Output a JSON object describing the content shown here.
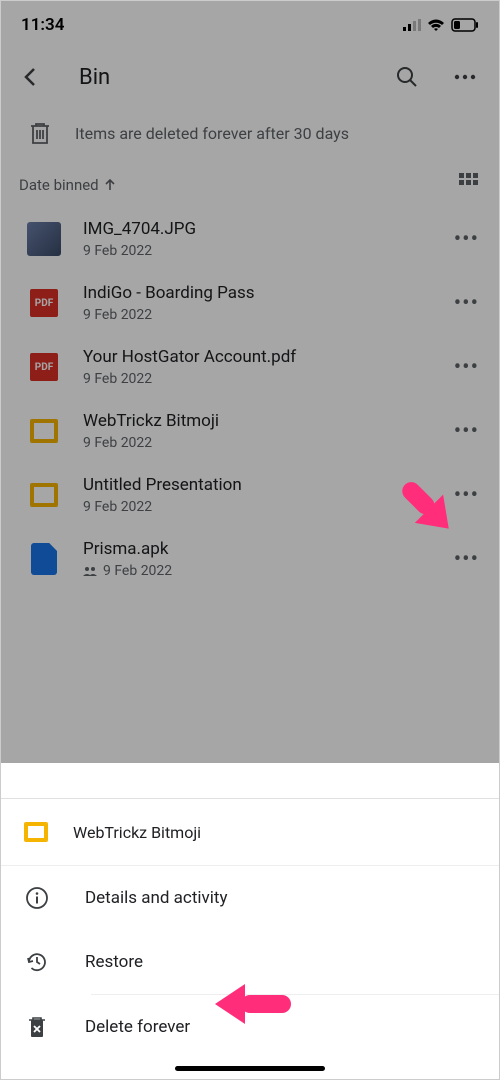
{
  "status": {
    "time": "11:34"
  },
  "header": {
    "title": "Bin"
  },
  "banner": {
    "text": "Items are deleted forever after 30 days"
  },
  "sort": {
    "label": "Date binned"
  },
  "files": [
    {
      "name": "IMG_4704.JPG",
      "date": "9 Feb 2022",
      "type": "img"
    },
    {
      "name": "IndiGo - Boarding Pass",
      "date": "9 Feb 2022",
      "type": "pdf"
    },
    {
      "name": "Your HostGator Account.pdf",
      "date": "9 Feb 2022",
      "type": "pdf"
    },
    {
      "name": "WebTrickz Bitmoji",
      "date": "9 Feb 2022",
      "type": "slides"
    },
    {
      "name": "Untitled Presentation",
      "date": "9 Feb 2022",
      "type": "slides"
    },
    {
      "name": "Prisma.apk",
      "date": "9 Feb 2022",
      "type": "file",
      "shared": true
    }
  ],
  "sheet": {
    "title": "WebTrickz Bitmoji",
    "actions": {
      "details": "Details and activity",
      "restore": "Restore",
      "delete": "Delete forever"
    }
  }
}
